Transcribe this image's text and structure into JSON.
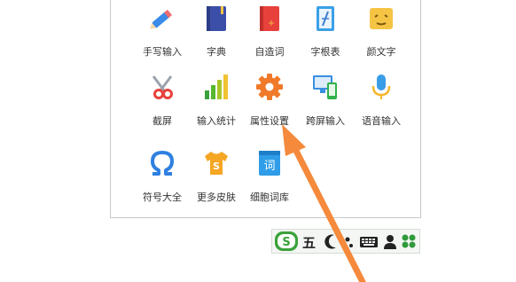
{
  "tools": [
    {
      "label": "手写输入",
      "icon": "pencil-icon"
    },
    {
      "label": "字典",
      "icon": "dictionary-book-icon"
    },
    {
      "label": "自造词",
      "icon": "custom-word-book-icon"
    },
    {
      "label": "字根表",
      "icon": "radical-table-icon"
    },
    {
      "label": "颜文字",
      "icon": "emoticon-icon"
    },
    {
      "label": "截屏",
      "icon": "scissors-icon"
    },
    {
      "label": "输入统计",
      "icon": "bar-chart-icon"
    },
    {
      "label": "属性设置",
      "icon": "gear-icon"
    },
    {
      "label": "跨屏输入",
      "icon": "cross-screen-device-icon"
    },
    {
      "label": "语音输入",
      "icon": "microphone-icon"
    },
    {
      "label": "符号大全",
      "icon": "omega-symbol-icon"
    },
    {
      "label": "更多皮肤",
      "icon": "tshirt-skin-icon"
    },
    {
      "label": "细胞词库",
      "icon": "cell-lexicon-icon"
    }
  ],
  "statusbar": {
    "logo_letter": "S",
    "mode_text": "五",
    "icons": [
      "sogou-logo-icon",
      "moon-icon",
      "punctuation-icon",
      "keyboard-icon",
      "user-icon",
      "toolbox-icon"
    ]
  },
  "colors": {
    "arrow": "#f58a3c",
    "accent_green": "#3aa23a",
    "panel_border": "#c8c8c8"
  }
}
